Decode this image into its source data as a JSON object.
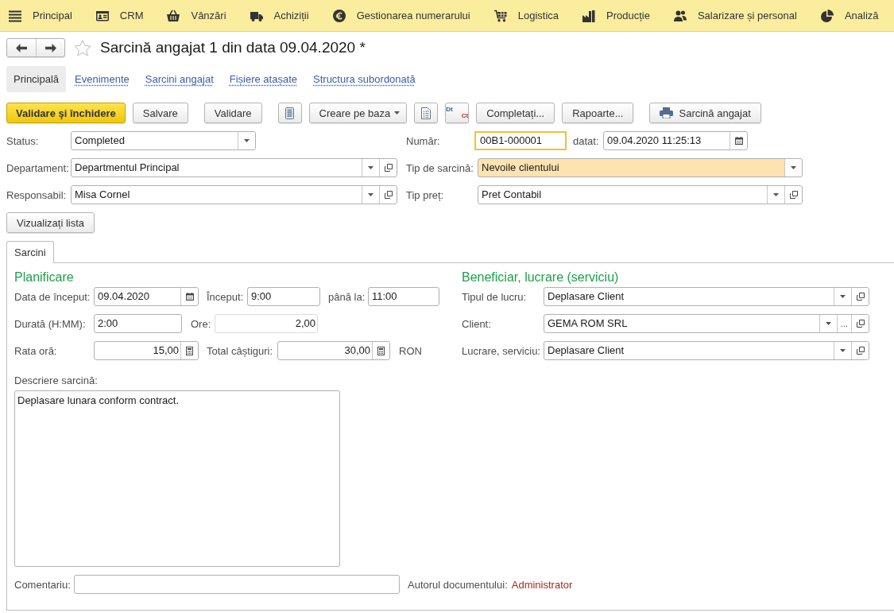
{
  "main_menu": [
    {
      "label": "Principal"
    },
    {
      "label": "CRM"
    },
    {
      "label": "Vânzări"
    },
    {
      "label": "Achiziții"
    },
    {
      "label": "Gestionarea numerarului"
    },
    {
      "label": "Logistica"
    },
    {
      "label": "Producție"
    },
    {
      "label": "Salarizare și personal"
    },
    {
      "label": "Analiză"
    }
  ],
  "window": {
    "title": "Sarcină angajat 1 din data 09.04.2020 *",
    "favorite": false
  },
  "nav_tabs": [
    {
      "label": "Principală",
      "selected": true
    },
    {
      "label": "Evenimente",
      "selected": false
    },
    {
      "label": "Sarcini angajat",
      "selected": false
    },
    {
      "label": "Fișiere atașate",
      "selected": false
    },
    {
      "label": "Structura subordonată",
      "selected": false
    }
  ],
  "toolbar": {
    "groups": [
      {
        "buttons": [
          {
            "kind": "primary",
            "label": "Validare şi închidere"
          },
          {
            "kind": "text",
            "label": "Salvare"
          }
        ]
      },
      {
        "buttons": [
          {
            "kind": "text",
            "label": "Validare"
          }
        ]
      },
      {
        "buttons": [
          {
            "kind": "list"
          },
          {
            "kind": "menu",
            "label": "Creare pe baza"
          },
          {
            "kind": "document"
          },
          {
            "kind": "dtct",
            "label_top": "Dt",
            "label_bottom": "Ct"
          },
          {
            "kind": "text",
            "label": "Completați..."
          },
          {
            "kind": "text",
            "label": "Rapoarte..."
          }
        ]
      },
      {
        "buttons": [
          {
            "kind": "print",
            "label": "Sarcină angajat"
          }
        ]
      }
    ]
  },
  "header": {
    "left": [
      {
        "label": "Status:",
        "value": "Completed",
        "kind": "text",
        "dropdown": true,
        "open_button": false
      },
      {
        "label": "Departament:",
        "value": "Departmentul Principal",
        "kind": "text",
        "dropdown": true,
        "open_button": true
      },
      {
        "label": "Responsabil:",
        "value": "Misa Cornel",
        "kind": "text",
        "dropdown": true,
        "open_button": true
      }
    ],
    "number": {
      "label": "Număr:",
      "value": "00B1-000001",
      "kind": "text",
      "focused": true
    },
    "date": {
      "label": "datat:",
      "value": "09.04.2020 11:25:13",
      "kind": "text",
      "calendar_button": true
    },
    "right": [
      {
        "label": "Tip de sarcină:",
        "value": "Nevoile clientului",
        "kind": "text",
        "dropdown": true,
        "open_button": false,
        "highlighted": true
      },
      {
        "label": "Tip preț:",
        "value": "Pret Contabil",
        "kind": "text",
        "dropdown": true,
        "open_button": true,
        "highlighted": false
      }
    ]
  },
  "view_list_button": "Vizualizați lista",
  "tabs": [
    {
      "label": "Sarcini",
      "selected": true
    }
  ],
  "planning": {
    "title": "Planificare",
    "rows": [
      {
        "fields": [
          {
            "label": "Data de început:",
            "value": "09.04.2020",
            "kind": "text",
            "calendar_button": true
          },
          {
            "label": "Început:",
            "value": "9:00",
            "kind": "text"
          },
          {
            "label": "până la:",
            "value": "11:00",
            "kind": "text"
          }
        ]
      },
      {
        "fields": [
          {
            "label": "Durată (H:MM):",
            "value": "2:00",
            "kind": "text"
          },
          {
            "label": "Ore:",
            "value": "2,00",
            "kind": "number",
            "readonly": true
          }
        ]
      },
      {
        "fields": [
          {
            "label": "Rata oră:",
            "value": "15,00",
            "kind": "number",
            "calculator_button": true
          },
          {
            "label": "Total câștiguri:",
            "value": "30,00",
            "kind": "number",
            "calculator_button": true,
            "unit": "RON"
          }
        ]
      }
    ]
  },
  "beneficiary": {
    "title": "Beneficiar, lucrare (serviciu)",
    "fields": [
      {
        "label": "Tipul de lucru:",
        "value": "Deplasare Client",
        "kind": "text",
        "dropdown": true,
        "open_button": true
      },
      {
        "label": "Client:",
        "value": "GEMA ROM SRL",
        "kind": "text",
        "dropdown": true,
        "choice_button": "...",
        "open_button": true
      },
      {
        "label": "Lucrare, serviciu:",
        "value": "Deplasare Client",
        "kind": "text",
        "dropdown": true,
        "open_button": true
      }
    ]
  },
  "description": {
    "label": "Descriere sarcină:",
    "value": "Deplasare lunara conform contract."
  },
  "comment": {
    "label": "Comentariu:"
  },
  "author": {
    "label": "Autorul documentului:",
    "value": "Administrator"
  }
}
